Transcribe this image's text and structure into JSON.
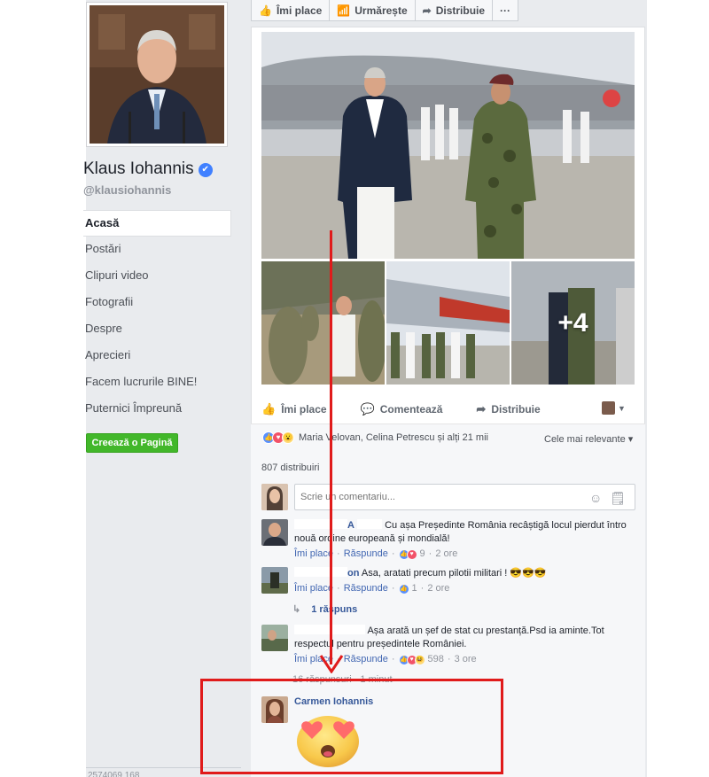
{
  "page": {
    "name": "Klaus Iohannis",
    "handle": "@klausiohannis",
    "verified_badge": "✔"
  },
  "colors": {
    "link_blue": "#365899",
    "create_green": "#42b72a",
    "annotation_red": "#e01b1b",
    "like_blue": "#5890ff"
  },
  "sidebar": {
    "items": [
      {
        "label": "Acasă",
        "active": true
      },
      {
        "label": "Postări"
      },
      {
        "label": "Clipuri video"
      },
      {
        "label": "Fotografii"
      },
      {
        "label": "Despre"
      },
      {
        "label": "Aprecieri"
      },
      {
        "label": "Facem lucrurile BINE!"
      },
      {
        "label": "Puternici Împreună"
      }
    ],
    "create_button": "Creează o Pagină",
    "footer_text": "2574069 168"
  },
  "top_actions": {
    "like": "Îmi place",
    "follow": "Urmărește",
    "share": "Distribuie",
    "more": "···"
  },
  "post": {
    "more_photos": "+4",
    "actions": {
      "like": "Îmi place",
      "comment": "Comentează",
      "share": "Distribuie"
    },
    "reactions_text": "Maria Velovan, Celina Petrescu și alți 21 mii",
    "sort": "Cele mai relevante ▾",
    "shares": "807 distribuiri",
    "comment_placeholder": "Scrie un comentariu..."
  },
  "comments": [
    {
      "name_suffix": "A",
      "text": "Cu așa Președinte România recâștigă locul pierdut întro nouă ordine europeană și mondială!",
      "like": "Îmi place",
      "reply": "Răspunde",
      "count": "9",
      "time": "2 ore"
    },
    {
      "name_suffix": "on",
      "text": "Asa, aratati precum pilotii militari ! 😎😎😎",
      "like": "Îmi place",
      "reply": "Răspunde",
      "count": "1",
      "time": "2 ore",
      "replies": "1 răspuns"
    },
    {
      "name_suffix": "",
      "text": "Așa arată un șef de stat cu prestanță.Psd ia aminte.Tot respectul pentru președintele României.",
      "like": "Îmi place",
      "reply": "Răspunde",
      "count": "598",
      "time": "3 ore",
      "replies": "16 răspunsuri · 1 minut"
    },
    {
      "name": "Carmen Iohannis",
      "emoji": "😍"
    }
  ]
}
